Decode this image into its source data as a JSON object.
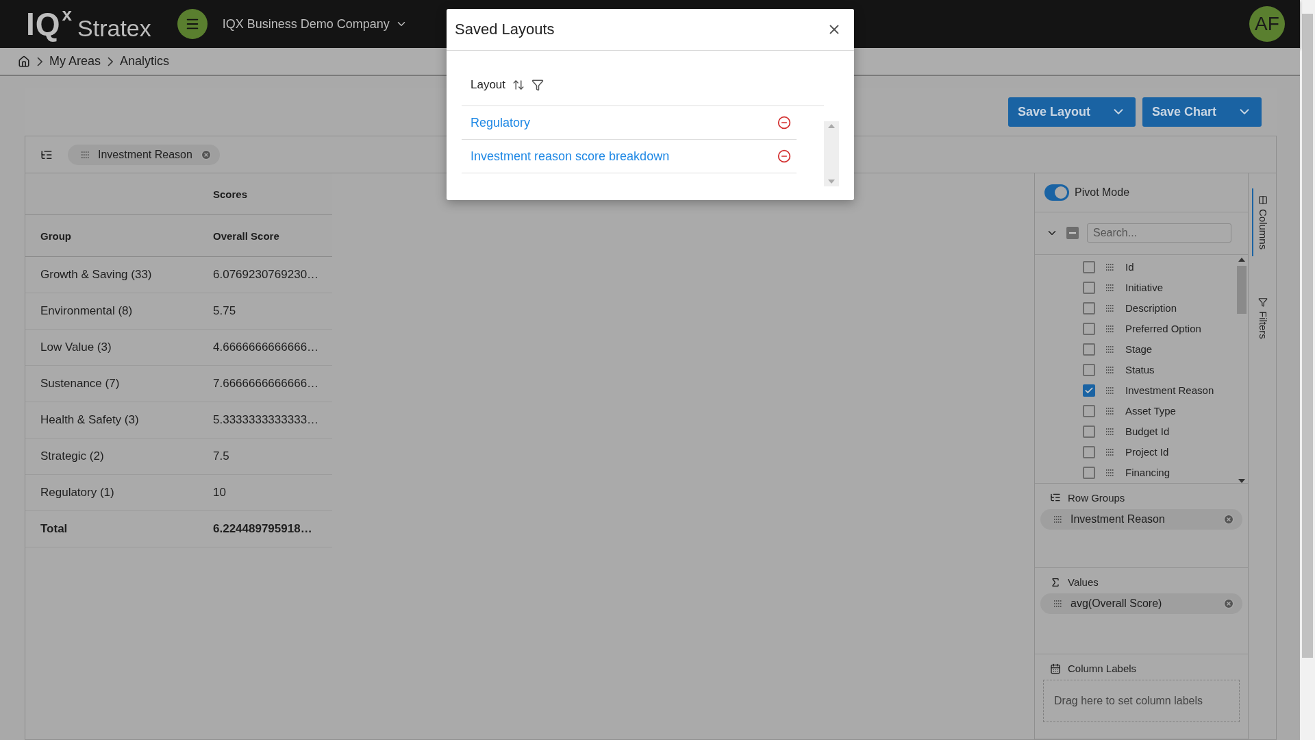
{
  "app": {
    "logo": {
      "mark": "IQ",
      "sup": "x",
      "name": "Stratex"
    },
    "company": "IQX Business Demo Company",
    "avatar": "AF"
  },
  "breadcrumb": [
    "My Areas",
    "Analytics"
  ],
  "toolbar": {
    "buttons": [
      "Save Layout",
      "Save Chart"
    ]
  },
  "row_group_bar": {
    "chips": [
      "Investment Reason"
    ]
  },
  "grid": {
    "group_header": "Scores",
    "columns": [
      "Group",
      "Overall Score"
    ],
    "rows": [
      {
        "group": "Growth & Saving (33)",
        "score": "6.0769230769230…"
      },
      {
        "group": "Environmental (8)",
        "score": "5.75"
      },
      {
        "group": "Low Value (3)",
        "score": "4.6666666666666…"
      },
      {
        "group": "Sustenance (7)",
        "score": "7.6666666666666…"
      },
      {
        "group": "Health & Safety (3)",
        "score": "5.3333333333333…"
      },
      {
        "group": "Strategic (2)",
        "score": "7.5"
      },
      {
        "group": "Regulatory (1)",
        "score": "10"
      }
    ],
    "total": {
      "label": "Total",
      "score": "6.224489795918…"
    }
  },
  "side_panel": {
    "pivot_mode": {
      "label": "Pivot Mode",
      "on": true
    },
    "select_all": {
      "indeterminate": true
    },
    "search": {
      "placeholder": "Search..."
    },
    "columns": [
      {
        "label": "Id",
        "checked": false
      },
      {
        "label": "Initiative",
        "checked": false
      },
      {
        "label": "Description",
        "checked": false
      },
      {
        "label": "Preferred Option",
        "checked": false
      },
      {
        "label": "Stage",
        "checked": false
      },
      {
        "label": "Status",
        "checked": false
      },
      {
        "label": "Investment Reason",
        "checked": true
      },
      {
        "label": "Asset Type",
        "checked": false
      },
      {
        "label": "Budget Id",
        "checked": false
      },
      {
        "label": "Project Id",
        "checked": false
      },
      {
        "label": "Financing",
        "checked": false
      }
    ],
    "row_groups": {
      "title": "Row Groups",
      "chips": [
        "Investment Reason"
      ]
    },
    "values": {
      "title": "Values",
      "chips": [
        "avg(Overall Score)"
      ]
    },
    "column_labels": {
      "title": "Column Labels",
      "placeholder": "Drag here to set column labels"
    }
  },
  "side_tabs": [
    {
      "label": "Columns",
      "kind": "columns",
      "selected": true
    },
    {
      "label": "Filters",
      "kind": "filters",
      "selected": false
    }
  ],
  "dialog": {
    "title": "Saved Layouts",
    "column": "Layout",
    "items": [
      "Regulatory",
      "Investment reason score breakdown"
    ]
  }
}
